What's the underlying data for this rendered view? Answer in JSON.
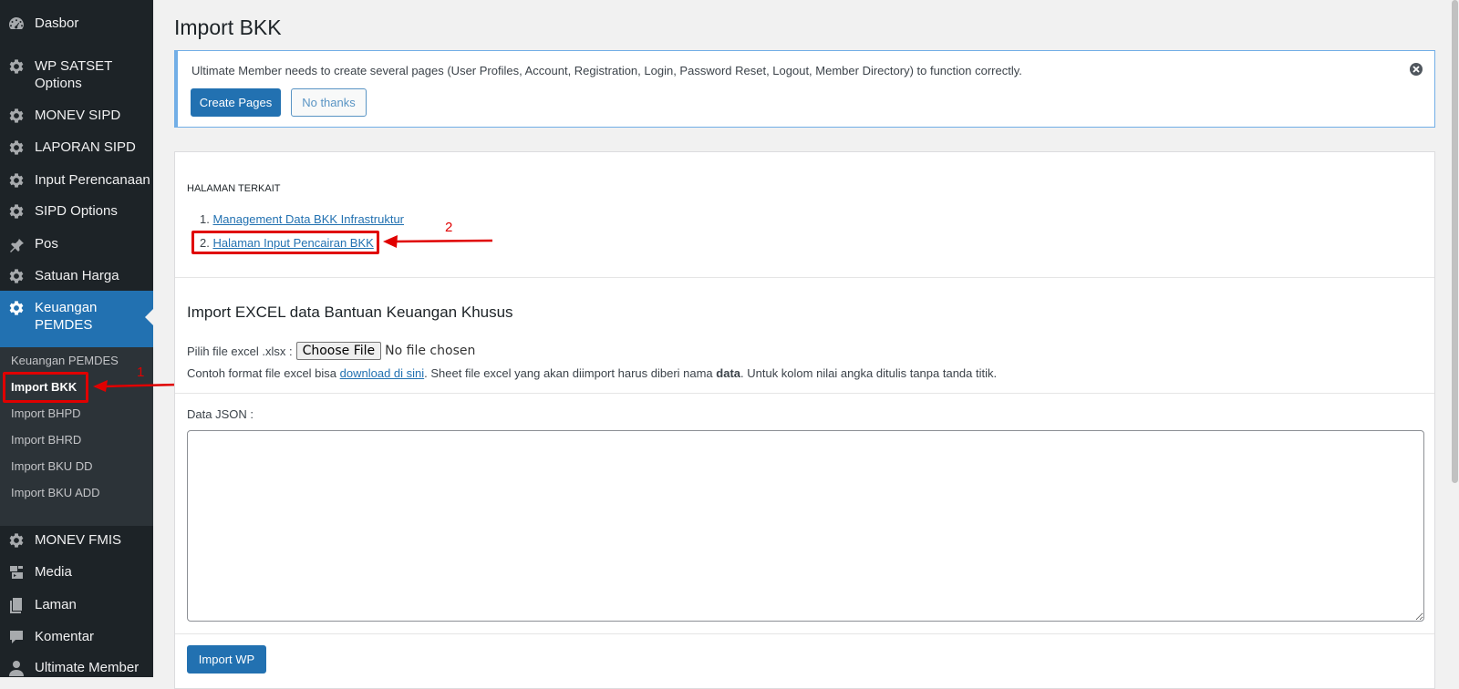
{
  "sidebar": {
    "items": [
      {
        "label": "Dasbor",
        "icon": "dashboard-icon"
      },
      {
        "label": "WP SATSET Options",
        "icon": "gear-icon"
      },
      {
        "label": "MONEV SIPD",
        "icon": "gear-icon"
      },
      {
        "label": "LAPORAN SIPD",
        "icon": "gear-icon"
      },
      {
        "label": "Input Perencanaan",
        "icon": "gear-icon"
      },
      {
        "label": "SIPD Options",
        "icon": "gear-icon"
      },
      {
        "label": "Pos",
        "icon": "pin-icon"
      },
      {
        "label": "Satuan Harga",
        "icon": "gear-icon"
      },
      {
        "label": "Keuangan PEMDES",
        "icon": "gear-icon"
      },
      {
        "label": "MONEV FMIS",
        "icon": "gear-icon"
      },
      {
        "label": "Media",
        "icon": "media-icon"
      },
      {
        "label": "Laman",
        "icon": "page-icon"
      },
      {
        "label": "Komentar",
        "icon": "comment-icon"
      },
      {
        "label": "Ultimate Member",
        "icon": "user-icon"
      }
    ],
    "submenu": [
      {
        "label": "Keuangan PEMDES"
      },
      {
        "label": "Import BKK"
      },
      {
        "label": "Import BHPD"
      },
      {
        "label": "Import BHRD"
      },
      {
        "label": "Import BKU DD"
      },
      {
        "label": "Import BKU ADD"
      }
    ]
  },
  "page": {
    "title": "Import BKK"
  },
  "notice": {
    "text": "Ultimate Member needs to create several pages (User Profiles, Account, Registration, Login, Password Reset, Logout, Member Directory) to function correctly.",
    "create_label": "Create Pages",
    "dismiss_label": "No thanks"
  },
  "related": {
    "heading": "HALAMAN TERKAIT",
    "links": [
      {
        "num": "1.",
        "label": "Management Data BKK Infrastruktur"
      },
      {
        "num": "2.",
        "label": "Halaman Input Pencairan BKK"
      }
    ]
  },
  "import": {
    "title": "Import EXCEL data Bantuan Keuangan Khusus",
    "file_label": "Pilih file excel .xlsx :",
    "choose_label": "Choose File",
    "no_file": "No file chosen",
    "help_prefix": "Contoh format file excel bisa ",
    "help_link": "download di sini",
    "help_middle": ". Sheet file excel yang akan diimport harus diberi nama ",
    "help_bold": "data",
    "help_suffix": ". Untuk kolom nilai angka ditulis tanpa tanda titik.",
    "json_label": "Data JSON :",
    "json_value": "",
    "submit_label": "Import WP"
  },
  "annotations": {
    "label_1": "1",
    "label_2": "2"
  },
  "colors": {
    "sidebar_bg": "#1d2327",
    "submenu_bg": "#2c3338",
    "accent": "#2271b1",
    "annotation": "#e00000"
  }
}
